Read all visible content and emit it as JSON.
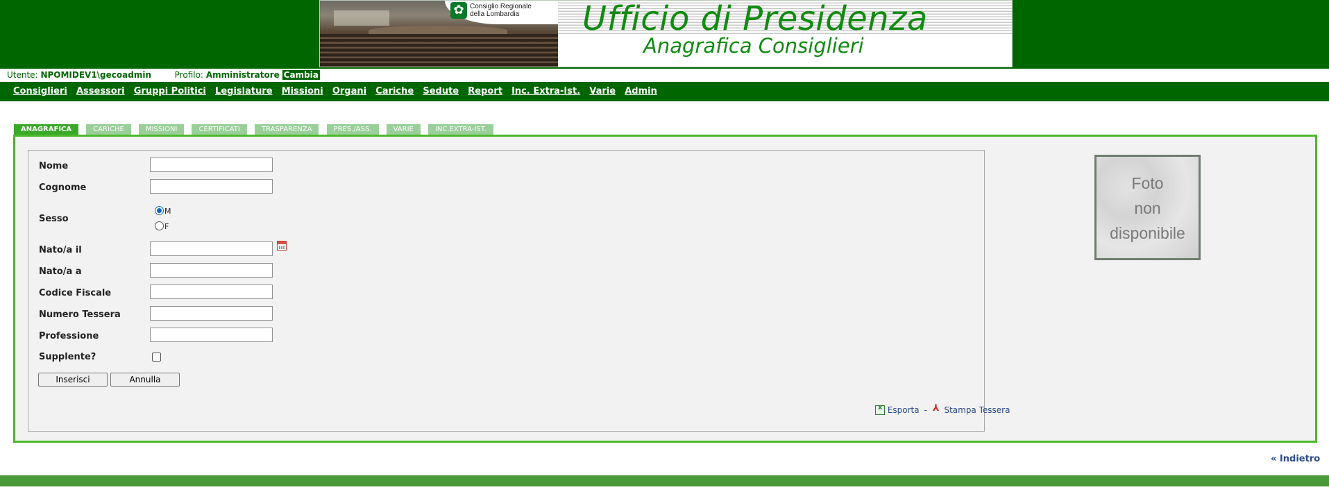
{
  "banner": {
    "title": "Ufficio di Presidenza",
    "subtitle": "Anagrafica Consiglieri",
    "logo_line1": "Consiglio Regionale",
    "logo_line2": "della Lombardia"
  },
  "userbar": {
    "user_label": "Utente:",
    "user_value": "NPOMIDEV1\\gecoadmin",
    "profile_label": "Profilo:",
    "profile_value": "Amministratore",
    "change_label": "Cambia"
  },
  "nav": {
    "items": [
      "Consiglieri",
      "Assessori",
      "Gruppi Politici",
      "Legislature",
      "Missioni",
      "Organi",
      "Cariche",
      "Sedute",
      "Report",
      "Inc. Extra-Ist.",
      "Varie",
      "Admin"
    ]
  },
  "tabs": [
    "ANAGRAFICA",
    "CARICHE",
    "MISSIONI",
    "CERTIFICATI",
    "TRASPARENZA",
    "PRES./ASS.",
    "VARIE",
    "INC.EXTRA-IST."
  ],
  "active_tab": "ANAGRAFICA",
  "form": {
    "nome_label": "Nome",
    "cognome_label": "Cognome",
    "sesso_label": "Sesso",
    "sesso_m": "M",
    "sesso_f": "F",
    "sesso_selected": "M",
    "nato_il_label": "Nato/a il",
    "nato_a_label": "Nato/a a",
    "codice_fiscale_label": "Codice Fiscale",
    "numero_tessera_label": "Numero Tessera",
    "professione_label": "Professione",
    "supplente_label": "Supplente?",
    "supplente_checked": false,
    "nome_value": "",
    "cognome_value": "",
    "nato_il_value": "",
    "nato_a_value": "",
    "codice_fiscale_value": "",
    "numero_tessera_value": "",
    "professione_value": "",
    "insert_button": "Inserisci",
    "cancel_button": "Annulla"
  },
  "export": {
    "export_label": "Esporta",
    "separator": "-",
    "print_card_label": "Stampa Tessera"
  },
  "photo": {
    "line1": "Foto",
    "line2": "non",
    "line3": "disponibile"
  },
  "back_link": "« Indietro",
  "colors": {
    "header_green": "#006600",
    "tab_active": "#3aa829",
    "tab_inactive": "#9acf9a",
    "panel_border": "#4cb82a",
    "link_blue": "#2a4a8a"
  }
}
